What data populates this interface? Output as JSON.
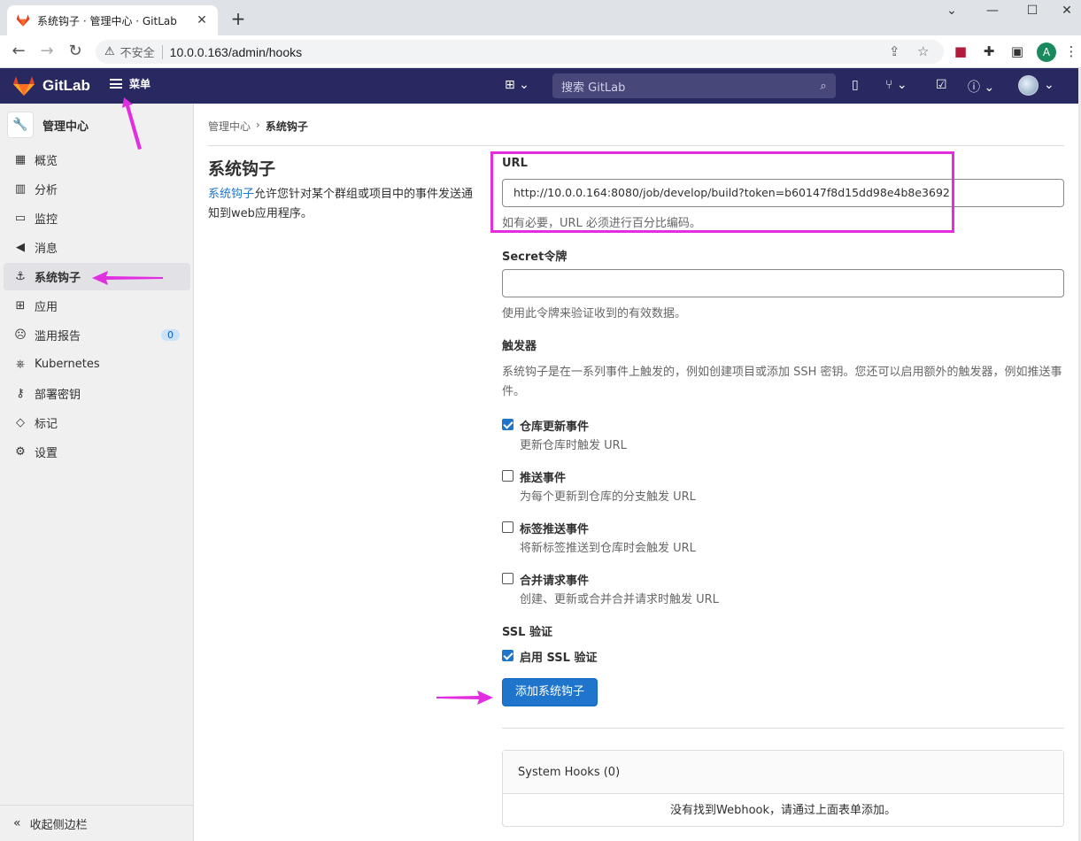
{
  "browser": {
    "tab_title": "系统钩子 · 管理中心 · GitLab",
    "insecure_label": "不安全",
    "url": "10.0.0.163/admin/hooks",
    "profile_initial": "A"
  },
  "topnav": {
    "brand": "GitLab",
    "menu_label": "菜单",
    "search_placeholder": "搜索 GitLab"
  },
  "sidebar": {
    "header": "管理中心",
    "items": [
      {
        "label": "概览",
        "icon": "overview-icon"
      },
      {
        "label": "分析",
        "icon": "analytics-icon"
      },
      {
        "label": "监控",
        "icon": "monitor-icon"
      },
      {
        "label": "消息",
        "icon": "messages-icon"
      },
      {
        "label": "系统钩子",
        "icon": "hook-icon",
        "active": true
      },
      {
        "label": "应用",
        "icon": "apps-icon"
      },
      {
        "label": "滥用报告",
        "icon": "abuse-icon",
        "badge": "0"
      },
      {
        "label": "Kubernetes",
        "icon": "kubernetes-icon"
      },
      {
        "label": "部署密钥",
        "icon": "key-icon"
      },
      {
        "label": "标记",
        "icon": "label-icon"
      },
      {
        "label": "设置",
        "icon": "gear-icon"
      }
    ],
    "collapse_label": "收起侧边栏"
  },
  "breadcrumb": {
    "parent": "管理中心",
    "current": "系统钩子"
  },
  "page": {
    "title": "系统钩子",
    "desc_link": "系统钩子",
    "desc_rest": "允许您针对某个群组或项目中的事件发送通知到web应用程序。"
  },
  "form": {
    "url_label": "URL",
    "url_value": "http://10.0.0.164:8080/job/develop/build?token=b60147f8d15dd98e4b8e3692",
    "url_help": "如有必要，URL 必须进行百分比编码。",
    "secret_label": "Secret令牌",
    "secret_value": "",
    "secret_help": "使用此令牌来验证收到的有效数据。",
    "triggers_label": "触发器",
    "triggers_help": "系统钩子是在一系列事件上触发的，例如创建项目或添加 SSH 密钥。您还可以启用额外的触发器，例如推送事件。",
    "triggers": [
      {
        "label": "仓库更新事件",
        "help": "更新仓库时触发 URL",
        "checked": true
      },
      {
        "label": "推送事件",
        "help": "为每个更新到仓库的分支触发 URL",
        "checked": false
      },
      {
        "label": "标签推送事件",
        "help": "将新标签推送到仓库时会触发 URL",
        "checked": false
      },
      {
        "label": "合并请求事件",
        "help": "创建、更新或合并合并请求时触发 URL",
        "checked": false
      }
    ],
    "ssl_label": "SSL 验证",
    "ssl_checkbox": "启用 SSL 验证",
    "ssl_checked": true,
    "submit_label": "添加系统钩子"
  },
  "hooks_list": {
    "header": "System Hooks (0)",
    "empty": "没有找到Webhook，请通过上面表单添加。"
  },
  "colors": {
    "nav_bg": "#292961",
    "accent": "#1f75cb",
    "annotation": "#e02ee0"
  }
}
